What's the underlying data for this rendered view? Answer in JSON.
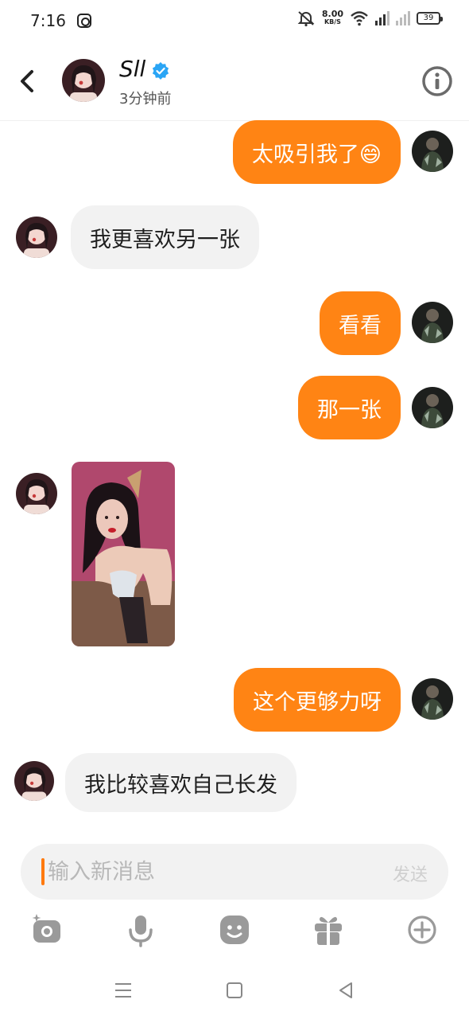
{
  "status_bar": {
    "time": "7:16",
    "net_speed": "8.00",
    "net_unit": "KB/S",
    "battery": "39"
  },
  "header": {
    "name": "Sll",
    "subtitle": "3分钟前"
  },
  "messages": [
    {
      "side": "out",
      "text": "太吸引我了😄"
    },
    {
      "side": "in",
      "text": "我更喜欢另一张"
    },
    {
      "side": "out",
      "text": "看看"
    },
    {
      "side": "out",
      "text": "那一张"
    },
    {
      "side": "in",
      "type": "image"
    },
    {
      "side": "out",
      "text": "这个更够力呀"
    },
    {
      "side": "in",
      "text": "我比较喜欢自己长发"
    }
  ],
  "input": {
    "placeholder": "输入新消息",
    "send_label": "发送"
  },
  "toolbar": [
    "camera-icon",
    "microphone-icon",
    "emoji-icon",
    "gift-icon",
    "plus-icon"
  ],
  "colors": {
    "outgoing_bubble": "#ff8414",
    "incoming_bubble": "#f2f2f2",
    "verified": "#2aa5f5",
    "accent_caret": "#ff7a0f"
  }
}
